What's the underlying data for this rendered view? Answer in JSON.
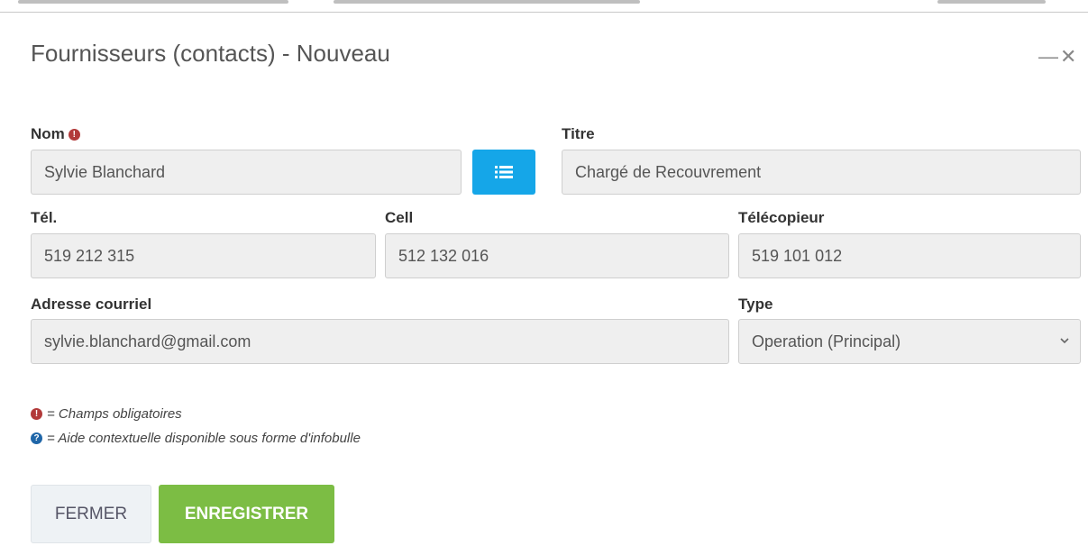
{
  "dialog": {
    "title": "Fournisseurs (contacts) - Nouveau",
    "minimize_icon": "minimize-icon",
    "close_icon": "close-icon"
  },
  "form": {
    "nom": {
      "label": "Nom",
      "value": "Sylvie Blanchard",
      "required": true
    },
    "titre": {
      "label": "Titre",
      "value": "Chargé de Recouvrement"
    },
    "tel": {
      "label": "Tél.",
      "value": "519 212 315"
    },
    "cell": {
      "label": "Cell",
      "value": "512 132 016"
    },
    "telecopieur": {
      "label": "Télécopieur",
      "value": "519 101 012"
    },
    "courriel": {
      "label": "Adresse courriel",
      "value": "sylvie.blanchard@gmail.com"
    },
    "type": {
      "label": "Type",
      "value": "Operation (Principal)"
    }
  },
  "legend": {
    "required_text": " = Champs obligatoires",
    "help_text": " = Aide contextuelle disponible sous forme d'infobulle"
  },
  "buttons": {
    "close_label": "FERMER",
    "save_label": "ENREGISTRER"
  },
  "colors": {
    "accent_blue": "#15a6e8",
    "save_green": "#7cbd44",
    "required_red": "#b23a3a",
    "help_blue": "#1f66a8"
  }
}
